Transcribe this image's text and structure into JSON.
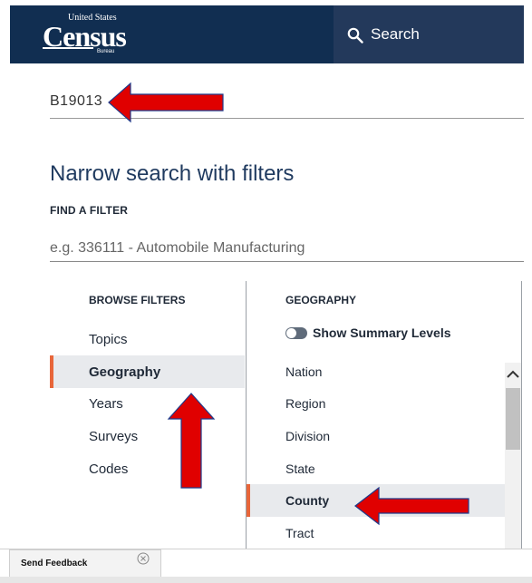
{
  "header": {
    "logo": {
      "top_text": "United States",
      "wordmark": "Census",
      "sub_text": "Bureau"
    },
    "search_label": "Search"
  },
  "query": {
    "value": "B19013"
  },
  "filters": {
    "title": "Narrow search with filters",
    "find_label": "FIND A FILTER",
    "find_placeholder": "e.g. 336111 - Automobile Manufacturing"
  },
  "browse": {
    "heading": "BROWSE FILTERS",
    "items": [
      {
        "label": "Topics"
      },
      {
        "label": "Geography"
      },
      {
        "label": "Years"
      },
      {
        "label": "Surveys"
      },
      {
        "label": "Codes"
      }
    ],
    "selected": "Geography"
  },
  "geography": {
    "heading": "GEOGRAPHY",
    "toggle_label": "Show Summary Levels",
    "toggle_on": false,
    "items": [
      {
        "label": "Nation"
      },
      {
        "label": "Region"
      },
      {
        "label": "Division"
      },
      {
        "label": "State"
      },
      {
        "label": "County"
      },
      {
        "label": "Tract"
      }
    ],
    "selected": "County"
  },
  "feedback": {
    "label": "Send Feedback"
  },
  "colors": {
    "header_bg": "#112e51",
    "search_bg": "#23395b",
    "accent": "#e8663a",
    "arrow_red": "#e00000",
    "selected_bg": "#e8eaed"
  },
  "icons": [
    "search-icon",
    "close-icon",
    "chevron-up-icon",
    "red-arrow-annotation"
  ]
}
